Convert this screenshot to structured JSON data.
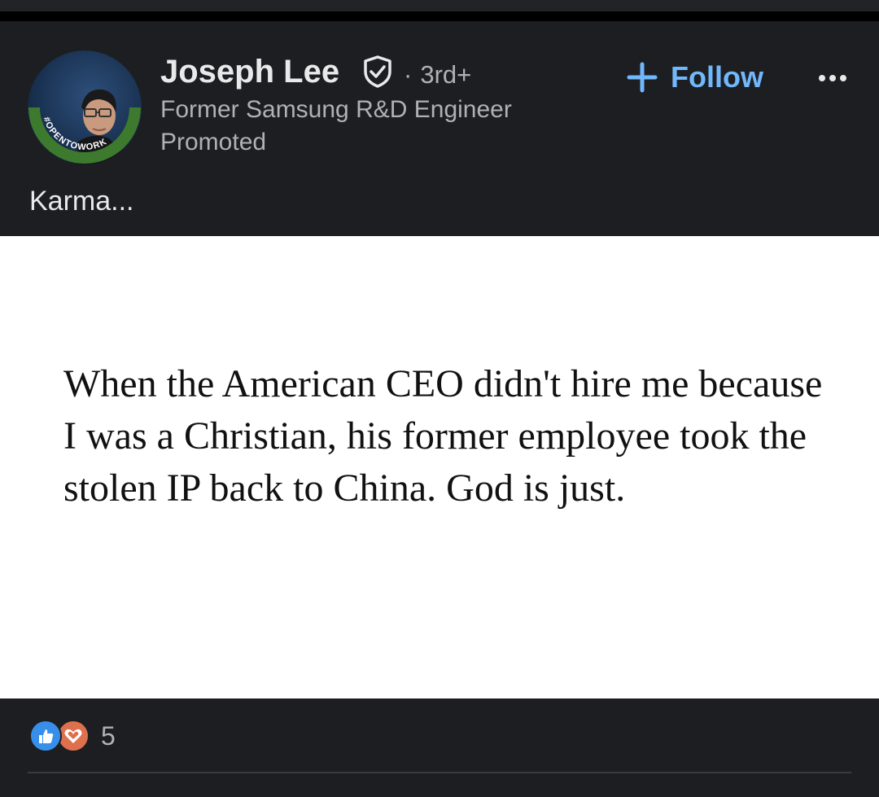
{
  "post": {
    "author": {
      "name": "Joseph Lee",
      "connection_degree": "3rd+",
      "separator": "·",
      "headline": "Former Samsung R&D Engineer",
      "promoted_label": "Promoted",
      "avatar_badge_text": "#OPENTOWORK"
    },
    "actions": {
      "follow_label": "Follow",
      "more_icon": "ellipsis-icon"
    },
    "caption": "Karma...",
    "image_text": "When the American CEO didn't hire me because I was a Christian, his former employee took the stolen IP back to China. God is just.",
    "reactions": {
      "count": "5",
      "types": [
        "like",
        "love"
      ]
    }
  },
  "colors": {
    "background": "#1d1e22",
    "follow_blue": "#71b7fb",
    "muted_text": "#b0b1b4",
    "primary_text": "#e9e9ea",
    "like_blue": "#378fe9",
    "love_orange": "#df704d",
    "open_to_work_green": "#3d7a2e"
  }
}
